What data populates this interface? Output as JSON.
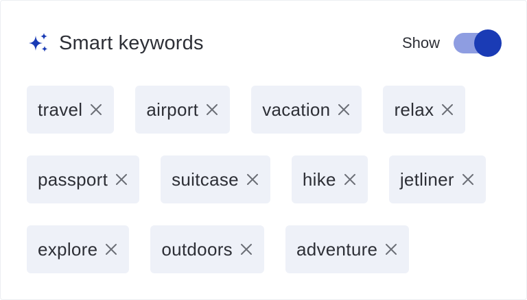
{
  "header": {
    "title": "Smart keywords",
    "icon": "sparkle-icon",
    "accent_color": "#1a3bb5"
  },
  "toggle": {
    "label": "Show",
    "state": "on",
    "track_color": "#8e9de1",
    "knob_color": "#1a3bb5"
  },
  "tags": {
    "rows": [
      {
        "items": [
          {
            "label": "travel"
          },
          {
            "label": "airport"
          },
          {
            "label": "vacation"
          },
          {
            "label": "relax"
          }
        ]
      },
      {
        "items": [
          {
            "label": "passport"
          },
          {
            "label": "suitcase"
          },
          {
            "label": "hike"
          },
          {
            "label": "jetliner"
          }
        ]
      },
      {
        "items": [
          {
            "label": "explore"
          },
          {
            "label": "outdoors"
          },
          {
            "label": "adventure"
          }
        ]
      }
    ],
    "remove_icon": "close-icon",
    "chip_color": "#eef1f8",
    "text_color": "#2d2f36",
    "remove_icon_color": "#6b6e76"
  }
}
